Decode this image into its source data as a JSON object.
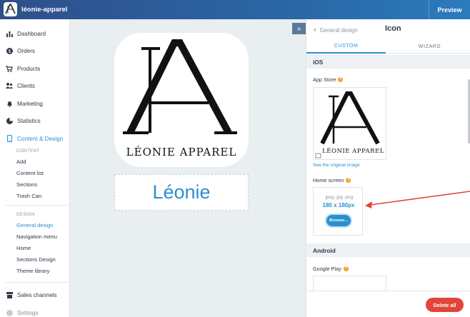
{
  "app": {
    "name": "léonie-apparel",
    "preview_label": "Preview"
  },
  "sidebar": {
    "items": [
      {
        "label": "Dashboard",
        "icon": "bar-chart-icon"
      },
      {
        "label": "Orders",
        "icon": "dollar-icon"
      },
      {
        "label": "Products",
        "icon": "cart-icon"
      },
      {
        "label": "Clients",
        "icon": "users-icon"
      },
      {
        "label": "Marketing",
        "icon": "bell-icon"
      },
      {
        "label": "Statistics",
        "icon": "pie-chart-icon"
      },
      {
        "label": "Content & Design",
        "icon": "phone-icon"
      },
      {
        "label": "Sales channels",
        "icon": "store-icon"
      },
      {
        "label": "Settings",
        "icon": "gear-icon"
      }
    ],
    "content_heading": "CONTENT",
    "content_items": [
      "Add",
      "Content list",
      "Sections",
      "Trash Can"
    ],
    "design_heading": "DESIGN",
    "design_items": [
      "General design",
      "Navigation menu",
      "Home",
      "Sections Design",
      "Theme library"
    ]
  },
  "canvas": {
    "brand_logo_text": "LÉONIE APPAREL",
    "app_name": "Léonie"
  },
  "panel": {
    "back_label": "General design",
    "title": "Icon",
    "tabs": [
      "CUSTOM",
      "WIZARD"
    ],
    "ios_heading": "iOS",
    "app_store_label": "App Store",
    "see_original_link": "See the original image",
    "home_screen_label": "Home screen",
    "upload_formats": ".jpeg .jpg .png",
    "upload_dims": "180 x 180px",
    "browse_label": "Browse...",
    "android_heading": "Android",
    "google_play_label": "Google Play",
    "delete_all_label": "Delete all"
  },
  "colors": {
    "accent": "#2b90cf",
    "danger": "#e2453a",
    "topbar": "#2a66a5"
  }
}
